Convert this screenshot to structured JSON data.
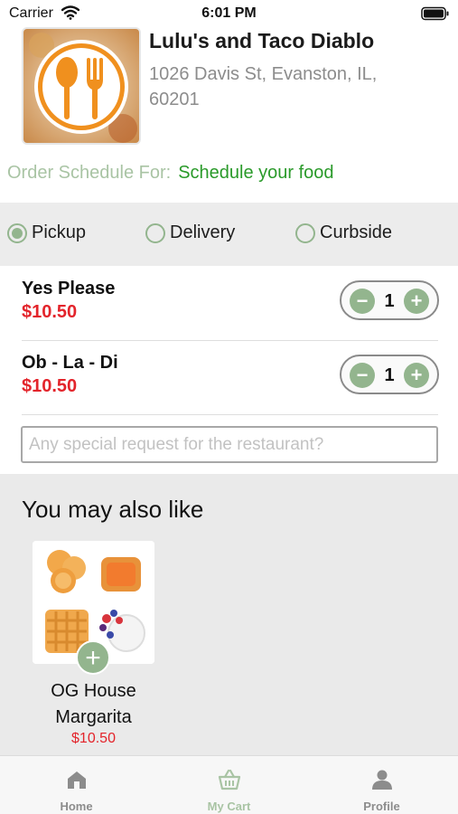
{
  "status_bar": {
    "carrier": "Carrier",
    "time": "6:01 PM"
  },
  "restaurant": {
    "name": "Lulu's and Taco Diablo",
    "address": "1026 Davis St, Evanston, IL, 60201",
    "logo_icon": "fork-spoon-icon"
  },
  "schedule": {
    "label": "Order Schedule For:",
    "link": "Schedule your food"
  },
  "order_types": [
    {
      "label": "Pickup",
      "selected": true
    },
    {
      "label": "Delivery",
      "selected": false
    },
    {
      "label": "Curbside",
      "selected": false
    }
  ],
  "cart_items": [
    {
      "name": "Yes Please",
      "price": "$10.50",
      "quantity": "1"
    },
    {
      "name": "Ob - La - Di",
      "price": "$10.50",
      "quantity": "1"
    }
  ],
  "special_request": {
    "placeholder": "Any special request for the restaurant?",
    "value": ""
  },
  "suggestions": {
    "title": "You may also like",
    "items": [
      {
        "name": "OG House Margarita",
        "price": "$10.50"
      }
    ]
  },
  "tab_bar": {
    "tabs": [
      {
        "label": "Home",
        "icon": "home-icon",
        "active": false
      },
      {
        "label": "My Cart",
        "icon": "basket-icon",
        "active": true
      },
      {
        "label": "Profile",
        "icon": "person-icon",
        "active": false
      }
    ]
  },
  "colors": {
    "accent_green": "#93b58e",
    "link_green": "#2a9a2a",
    "price_red": "#e3242b",
    "logo_orange": "#f0901e"
  }
}
